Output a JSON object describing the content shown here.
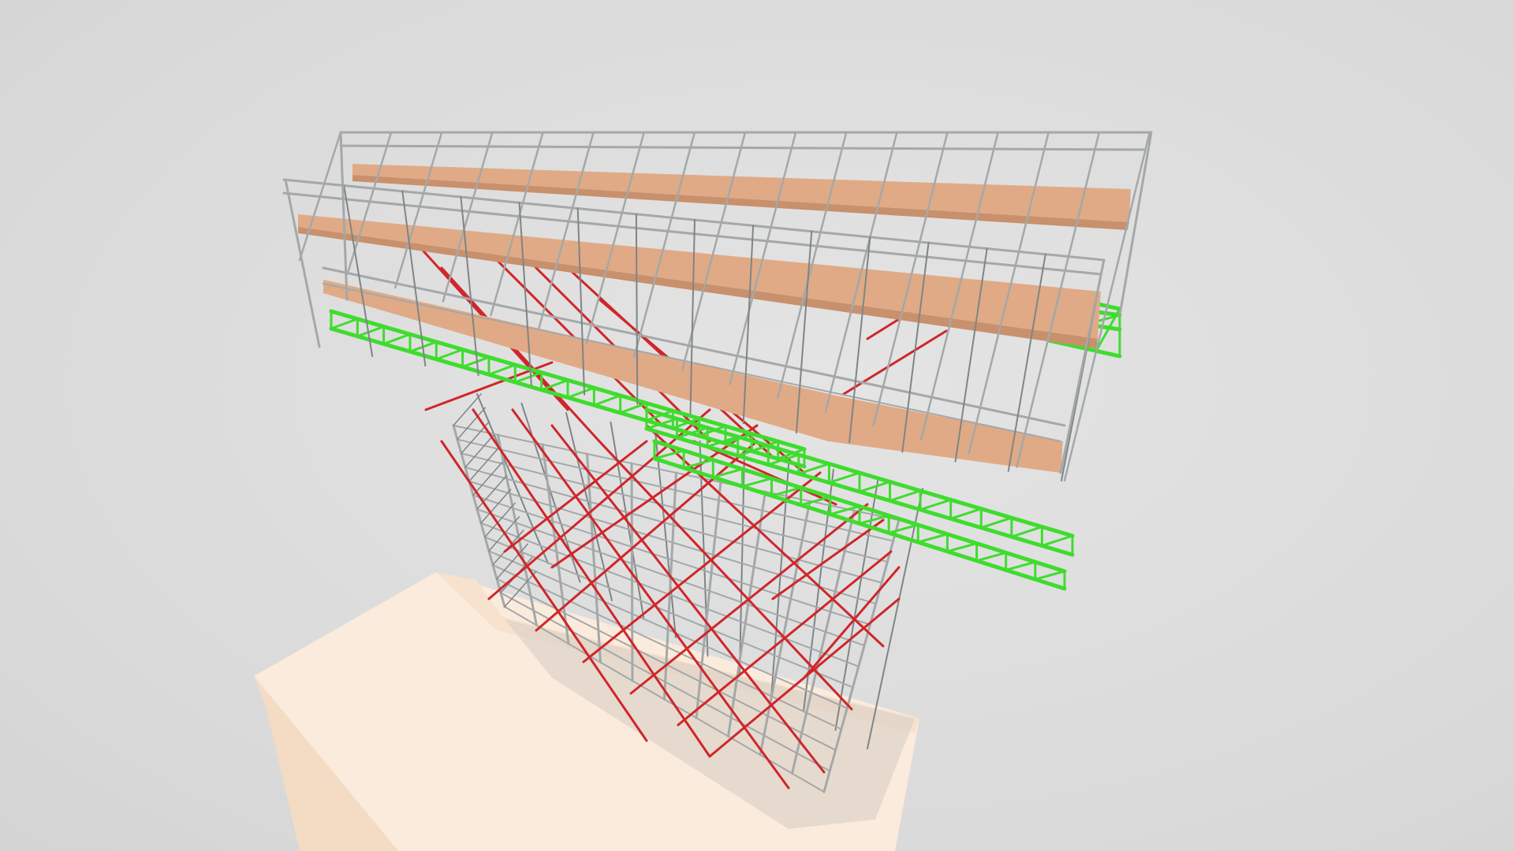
{
  "viewer": {
    "background_color": "#dcdcdc"
  },
  "model": {
    "colors": {
      "standard_tube": "#a4a8a8",
      "standard_tube_dark": "#7f8585",
      "diagonal_brace": "#d0262a",
      "truss_beam": "#3fdc2e",
      "timber_deck": "#e0aa86",
      "timber_deck_shade": "#c8906c",
      "ground_slab_top": "#fbebdc",
      "ground_slab_side": "#f3dcc3",
      "shadow": "#c9c2bb"
    },
    "icons": {
      "scene": "scaffold-3d-model"
    }
  }
}
